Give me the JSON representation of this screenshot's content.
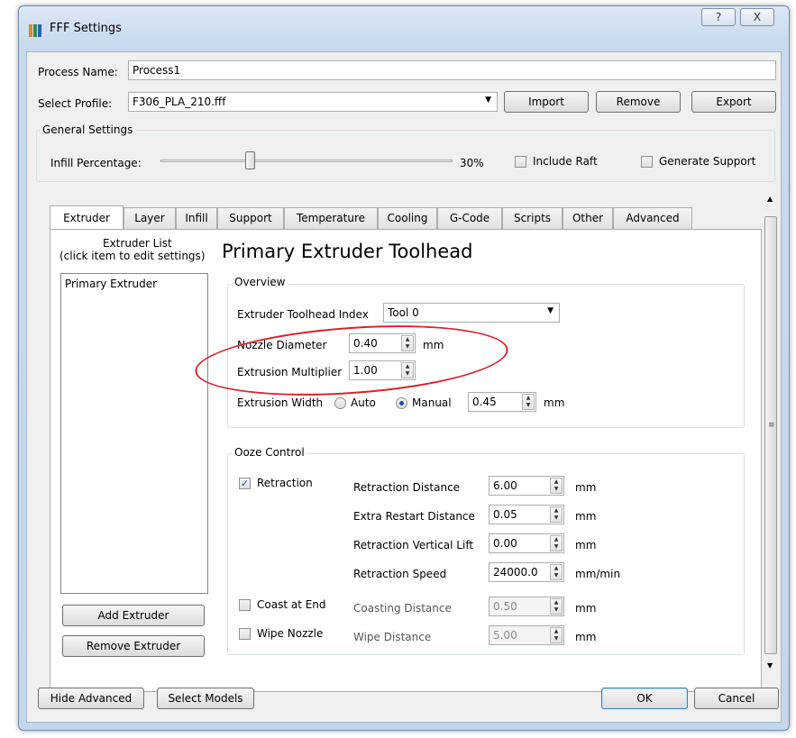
{
  "window": {
    "title": "FFF Settings",
    "help_button": "?",
    "close_button": "X"
  },
  "process_name": {
    "label": "Process Name:",
    "value": "Process1"
  },
  "profile": {
    "label": "Select Profile:",
    "value": "F306_PLA_210.fff",
    "import_label": "Import",
    "remove_label": "Remove",
    "export_label": "Export"
  },
  "general_settings": {
    "title": "General Settings",
    "infill_label": "Infill Percentage:",
    "infill_value": "30%",
    "infill_fraction": 0.3,
    "include_raft_label": "Include Raft",
    "include_raft_checked": false,
    "generate_support_label": "Generate Support",
    "generate_support_checked": false
  },
  "tabs": [
    {
      "label": "Extruder",
      "active": true
    },
    {
      "label": "Layer"
    },
    {
      "label": "Infill"
    },
    {
      "label": "Support"
    },
    {
      "label": "Temperature"
    },
    {
      "label": "Cooling"
    },
    {
      "label": "G-Code"
    },
    {
      "label": "Scripts"
    },
    {
      "label": "Other"
    },
    {
      "label": "Advanced"
    }
  ],
  "extruder_list": {
    "header_line1": "Extruder List",
    "header_line2": "(click item to edit settings)",
    "items": [
      "Primary Extruder"
    ],
    "add_label": "Add Extruder",
    "remove_label": "Remove Extruder"
  },
  "heading": "Primary Extruder Toolhead",
  "overview": {
    "title": "Overview",
    "toolhead_index_label": "Extruder Toolhead Index",
    "toolhead_index_value": "Tool 0",
    "nozzle_diameter_label": "Nozzle Diameter",
    "nozzle_diameter_value": "0.40",
    "nozzle_diameter_unit": "mm",
    "extrusion_multiplier_label": "Extrusion Multiplier",
    "extrusion_multiplier_value": "1.00",
    "extrusion_width_label": "Extrusion Width",
    "auto_label": "Auto",
    "manual_label": "Manual",
    "extrusion_width_mode": "Manual",
    "extrusion_width_value": "0.45",
    "extrusion_width_unit": "mm"
  },
  "ooze_control": {
    "title": "Ooze Control",
    "retraction_label": "Retraction",
    "retraction_checked": true,
    "coast_label": "Coast at End",
    "coast_checked": false,
    "wipe_label": "Wipe Nozzle",
    "wipe_checked": false,
    "rows": [
      {
        "label": "Retraction Distance",
        "value": "6.00",
        "unit": "mm",
        "enabled": true
      },
      {
        "label": "Extra Restart Distance",
        "value": "0.05",
        "unit": "mm",
        "enabled": true
      },
      {
        "label": "Retraction Vertical Lift",
        "value": "0.00",
        "unit": "mm",
        "enabled": true
      },
      {
        "label": "Retraction Speed",
        "value": "24000.0",
        "unit": "mm/min",
        "enabled": true
      },
      {
        "label": "Coasting Distance",
        "value": "0.50",
        "unit": "mm",
        "enabled": false
      },
      {
        "label": "Wipe Distance",
        "value": "5.00",
        "unit": "mm",
        "enabled": false
      }
    ]
  },
  "footer": {
    "hide_advanced_label": "Hide Advanced",
    "select_models_label": "Select Models",
    "ok_label": "OK",
    "cancel_label": "Cancel"
  },
  "colors": {
    "annotation": "#d9242b",
    "check": "#1f4ea8"
  },
  "icons": {
    "app": "simplify3d-app-icon",
    "spin": "updown-arrows-icon",
    "combo": "dropdown-arrow-icon"
  }
}
